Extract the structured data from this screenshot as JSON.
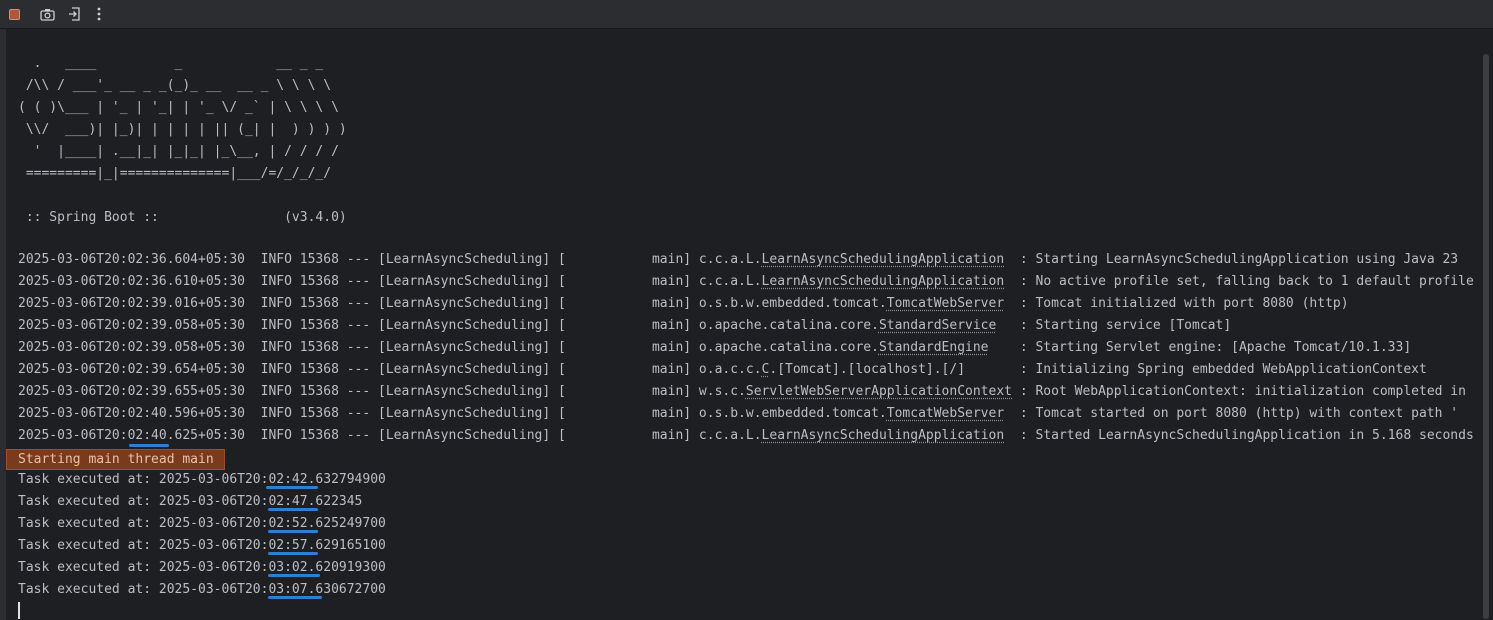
{
  "toolbar": {
    "items": [
      {
        "name": "stop-icon",
        "glyph": ""
      },
      {
        "name": "camera-icon",
        "glyph": "▣"
      },
      {
        "name": "exit-icon",
        "glyph": "⇥"
      },
      {
        "name": "more-icon",
        "glyph": "⋮"
      }
    ]
  },
  "banner": "  .   ____          _            __ _ _\n /\\\\ / ___'_ __ _ _(_)_ __  __ _ \\ \\ \\ \\\n( ( )\\___ | '_ | '_| | '_ \\/ _` | \\ \\ \\ \\\n \\\\/  ___)| |_)| | | | | || (_| |  ) ) ) )\n  '  |____| .__|_| |_|_| |_\\__, | / / / /\n =========|_|==============|___/=/_/_/_/\n\n :: Spring Boot ::                (v3.4.0)",
  "log_lines": [
    {
      "prefix": "2025-03-06T20:02:36.604+05:30  INFO 15368 --- [LearnAsyncScheduling] [           main] c.c.a.L.",
      "cls": "LearnAsyncSchedulingApplication",
      "suffix": "  : Starting LearnAsyncSchedulingApplication using Java 23"
    },
    {
      "prefix": "2025-03-06T20:02:36.610+05:30  INFO 15368 --- [LearnAsyncScheduling] [           main] c.c.a.L.",
      "cls": "LearnAsyncSchedulingApplication",
      "suffix": "  : No active profile set, falling back to 1 default profile"
    },
    {
      "prefix": "2025-03-06T20:02:39.016+05:30  INFO 15368 --- [LearnAsyncScheduling] [           main] o.s.b.w.embedded.tomcat.",
      "cls": "TomcatWebServer",
      "suffix": "  : Tomcat initialized with port 8080 (http)"
    },
    {
      "prefix": "2025-03-06T20:02:39.058+05:30  INFO 15368 --- [LearnAsyncScheduling] [           main] o.apache.catalina.core.",
      "cls": "StandardService",
      "suffix": "   : Starting service [Tomcat]"
    },
    {
      "prefix": "2025-03-06T20:02:39.058+05:30  INFO 15368 --- [LearnAsyncScheduling] [           main] o.apache.catalina.core.",
      "cls": "StandardEngine",
      "suffix": "    : Starting Servlet engine: [Apache Tomcat/10.1.33]"
    },
    {
      "prefix": "2025-03-06T20:02:39.654+05:30  INFO 15368 --- [LearnAsyncScheduling] [           main] o.a.c.c.",
      "cls": "C",
      "suffix": ".[Tomcat].[localhost].[/]       : Initializing Spring embedded WebApplicationContext"
    },
    {
      "prefix": "2025-03-06T20:02:39.655+05:30  INFO 15368 --- [LearnAsyncScheduling] [           main] w.s.c.",
      "cls": "ServletWebServerApplicationContext",
      "suffix": " : Root WebApplicationContext: initialization completed in"
    },
    {
      "prefix": "2025-03-06T20:02:40.596+05:30  INFO 15368 --- [LearnAsyncScheduling] [           main] o.s.b.w.embedded.tomcat.",
      "cls": "TomcatWebServer",
      "suffix": "  : Tomcat started on port 8080 (http) with context path '"
    },
    {
      "prefix": "2025-03-06T20:02:40.625+05:30  INFO 15368 --- [LearnAsyncScheduling] [           main] c.c.a.L.",
      "cls": "LearnAsyncSchedulingApplication",
      "suffix": "  : Started LearnAsyncSchedulingApplication in 5.168 seconds"
    }
  ],
  "highlight_text": "Starting main thread main",
  "task_lines": [
    "Task executed at: 2025-03-06T20:02:42.632794900",
    "Task executed at: 2025-03-06T20:02:47.622345",
    "Task executed at: 2025-03-06T20:02:52.625249700",
    "Task executed at: 2025-03-06T20:02:57.629165100",
    "Task executed at: 2025-03-06T20:03:02.620919300",
    "Task executed at: 2025-03-06T20:03:07.630672700"
  ],
  "colors": {
    "annotation": "#2f7fd1",
    "highlight": "#7a3a1e",
    "text": "#bcbec4"
  }
}
